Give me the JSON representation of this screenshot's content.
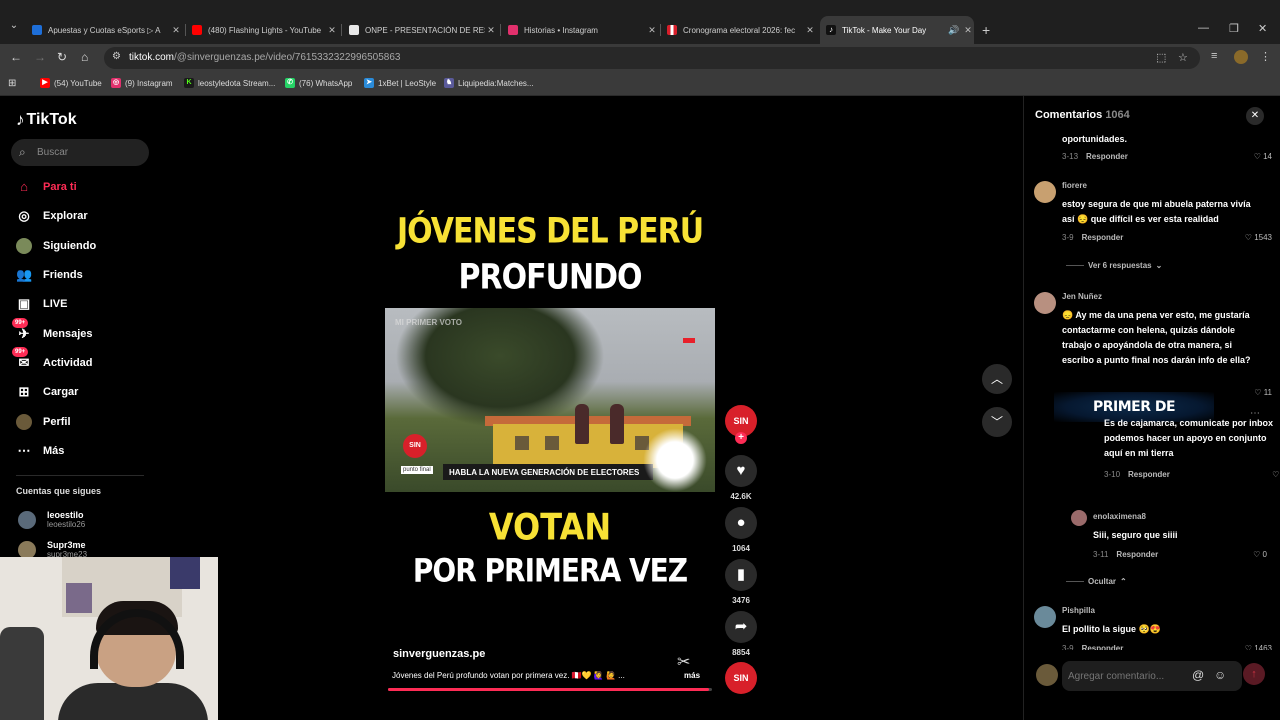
{
  "browser": {
    "tabs": [
      {
        "title": "Apuestas y Cuotas eSports ▷ A",
        "color": "#1e6fd9"
      },
      {
        "title": "(480) Flashing Lights - YouTube",
        "color": "#ff0000"
      },
      {
        "title": "ONPE - PRESENTACIÓN DE RES",
        "color": "#e8e8e8"
      },
      {
        "title": "Historias • Instagram",
        "color": "#e1306c"
      },
      {
        "title": "Cronograma electoral 2026: fec",
        "color": "#d91e2a"
      },
      {
        "title": "TikTok - Make Your Day",
        "color": "#111111"
      }
    ],
    "url_host": "tiktok.com",
    "url_path": "/@sinverguenzas.pe/video/7615332322996505863",
    "bookmarks": [
      {
        "label": "(54) YouTube",
        "color": "#ff0000",
        "glyph": "▶"
      },
      {
        "label": "(9) Instagram",
        "color": "#e1306c",
        "glyph": "◎"
      },
      {
        "label": "leostyledota Stream...",
        "color": "#53fc18",
        "glyph": "K"
      },
      {
        "label": "(76) WhatsApp",
        "color": "#25d366",
        "glyph": "✆"
      },
      {
        "label": "1xBet | LeoStyle",
        "color": "#2a8bd9",
        "glyph": "➤"
      },
      {
        "label": "Liquipedia:Matches...",
        "color": "#5a5a9a",
        "glyph": "♞"
      }
    ]
  },
  "sidebar": {
    "logo": "TikTok",
    "search_placeholder": "Buscar",
    "items": [
      {
        "label": "Para ti",
        "icon": "home-icon"
      },
      {
        "label": "Explorar",
        "icon": "compass-icon"
      },
      {
        "label": "Siguiendo",
        "icon": "following-avatar"
      },
      {
        "label": "Friends",
        "icon": "friends-icon"
      },
      {
        "label": "LIVE",
        "icon": "live-icon"
      },
      {
        "label": "Mensajes",
        "icon": "messages-icon",
        "badge": "99+"
      },
      {
        "label": "Actividad",
        "icon": "activity-icon",
        "badge": "99+"
      },
      {
        "label": "Cargar",
        "icon": "upload-icon"
      },
      {
        "label": "Perfil",
        "icon": "profile-avatar"
      },
      {
        "label": "Más",
        "icon": "more-icon"
      }
    ],
    "following_title": "Cuentas que sigues",
    "following": [
      {
        "name": "leoestilo",
        "handle": "leoestilo26"
      },
      {
        "name": "Supr3me",
        "handle": "supr3me23"
      }
    ]
  },
  "video": {
    "line1": "JÓVENES DEL PERÚ",
    "line2": "PROFUNDO",
    "line3": "VOTAN",
    "line4": "POR PRIMERA VEZ",
    "clip_banner": "HABLA LA NUEVA GENERACIÓN DE ELECTORES",
    "clip_watermark": "MI PRIMER VOTO",
    "clip_logo": "SIN",
    "clip_tag": "punto final",
    "author": "sinverguenzas.pe",
    "description": "Jóvenes del Perú profundo votan por primera vez. 🇵🇪💛 🙋‍♀️ 🙋 ...",
    "more": "más",
    "progress": 0.99
  },
  "actions": {
    "creator_logo": "SIN",
    "likes": "42.6K",
    "comments": "1064",
    "saves": "3476",
    "shares": "8854"
  },
  "comments": {
    "title": "Comentarios",
    "count": "1064",
    "items": [
      {
        "user": "",
        "text": "oportunidades.",
        "date": "3-13",
        "likes": "14"
      },
      {
        "user": "fiorere",
        "text": "estoy segura de que mi abuela paterna vivía así 😔 que difícil es ver esta realidad",
        "date": "3-9",
        "likes": "1543",
        "view_replies": "Ver 6 respuestas"
      },
      {
        "user": "Jen Nuñez",
        "text": "😞 Ay me da una pena ver esto, me gustaría contactarme con helena, quizás dándole trabajo o apoyándola de otra manera, si escribo a punto final nos darán info de ella?",
        "date": "",
        "likes": "11"
      },
      {
        "user": "",
        "text": "Es de cajamarca, comunicate por inbox podemos hacer un apoyo en conjunto aquí en mi tierra",
        "date": "3-10",
        "likes": "2"
      },
      {
        "user": "enolaximena8",
        "text": "Siii, seguro que siiii",
        "date": "3-11",
        "likes": "0",
        "hide": "Ocultar"
      },
      {
        "user": "Pishpilla",
        "text": "El pollito la sigue 🥺😍",
        "date": "3-9",
        "likes": "1463"
      }
    ],
    "reply_label": "Responder",
    "overlay_text": "PRIMER DE",
    "input_placeholder": "Agregar comentario..."
  }
}
